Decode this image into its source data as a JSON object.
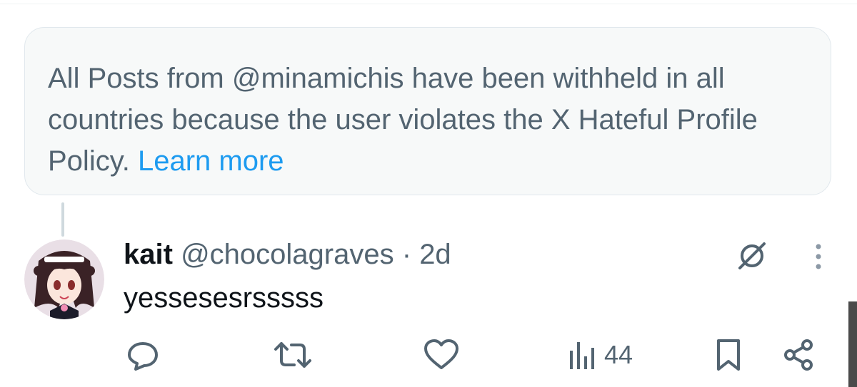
{
  "notice": {
    "text": "All Posts from @minamichis have been withheld in all countries because the user violates the X Hateful Profile Policy.",
    "link_label": "Learn more",
    "link_color": "#1d9bf0"
  },
  "post": {
    "author_name": "kait",
    "author_handle": "@chocolagraves",
    "separator": "·",
    "time": "2d",
    "text": "yessesesrsssss",
    "avatar_icon": "anime-avatar-icon",
    "actions": {
      "reply_icon": "reply-icon",
      "repost_icon": "repost-icon",
      "like_icon": "heart-icon",
      "views_icon": "views-icon",
      "views_count": "44",
      "bookmark_icon": "bookmark-icon",
      "share_icon": "share-icon"
    },
    "grok_icon": "grok-icon",
    "more_icon": "more-dots-icon"
  },
  "colors": {
    "secondary_text": "#536471",
    "primary_text": "#0f1419",
    "notice_bg": "#f7f9f9"
  }
}
